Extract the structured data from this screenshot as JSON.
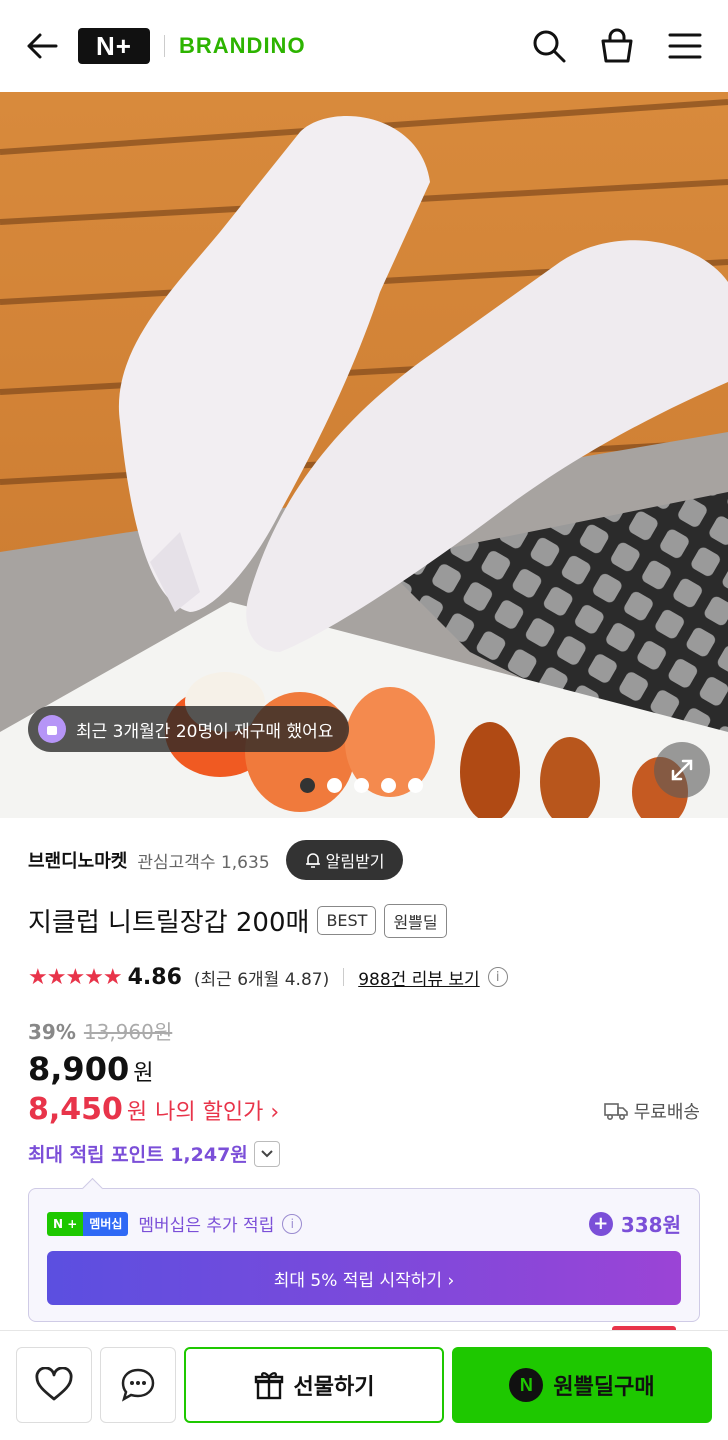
{
  "header": {
    "logo_text": "N+",
    "brand": "BRANDINO",
    "icons": [
      "back-arrow-icon",
      "search-icon",
      "shopping-bag-icon",
      "menu-icon"
    ]
  },
  "photo": {
    "repurchase_text": "최근 3개월간 20명이 재구매 했어요",
    "slide_count": 5,
    "active_slide": 1
  },
  "store": {
    "name": "브랜디노마켓",
    "followers": "관심고객수 1,635",
    "alarm_label": "알림받기"
  },
  "product": {
    "title": "지클럽 니트릴장갑 200매",
    "tags": [
      "BEST",
      "원쁠딜"
    ]
  },
  "rating": {
    "stars": "★★★★★",
    "score": "4.86",
    "recent": "(최근 6개월 4.87)",
    "review_link": "988건 리뷰 보기"
  },
  "price": {
    "discount_rate": "39%",
    "original": "13,960원",
    "current": "8,900",
    "currency": "원",
    "my_price": "8,450",
    "my_price_label": "나의 할인가 ›",
    "shipping": "무료배송"
  },
  "points": {
    "label": "최대 적립 포인트 1,247원"
  },
  "membership": {
    "badge_a": "N +",
    "badge_b": "멤버십",
    "text": "멤버십은 추가 적립",
    "points": "338원",
    "cta": "최대 5% 적립 시작하기 ›"
  },
  "bottom": {
    "gift_label": "선물하기",
    "buy_label": "원쁠딜구매",
    "buy_icon_letter": "N"
  },
  "colors": {
    "brand_green": "#2db400",
    "buy_green": "#1ec800",
    "rating_red": "#e8344a",
    "points_purple": "#7b4fd8"
  }
}
